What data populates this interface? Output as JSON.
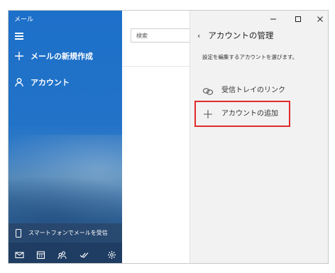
{
  "app": {
    "title": "メール"
  },
  "sidebar": {
    "new_mail": "メールの新規作成",
    "accounts": "アカウント",
    "phone_prompt": "スマートフォンでメールを受信",
    "bottom_icons": [
      "mail-icon",
      "calendar-icon",
      "people-icon",
      "todo-icon",
      "settings-icon"
    ]
  },
  "search": {
    "placeholder": "検索"
  },
  "panel": {
    "back_glyph": "‹",
    "title": "アカウントの管理",
    "description": "設定を編集するアカウントを選びます。",
    "options": [
      {
        "label": "受信トレイのリンク",
        "icon": "link-icon"
      },
      {
        "label": "アカウントの追加",
        "icon": "plus-icon"
      }
    ]
  },
  "colors": {
    "sidebar_blue": "#1d70c9",
    "bottom_bar": "#1f3d63",
    "panel_bg": "#f2f2f2",
    "highlight_red": "#e02a2a"
  }
}
